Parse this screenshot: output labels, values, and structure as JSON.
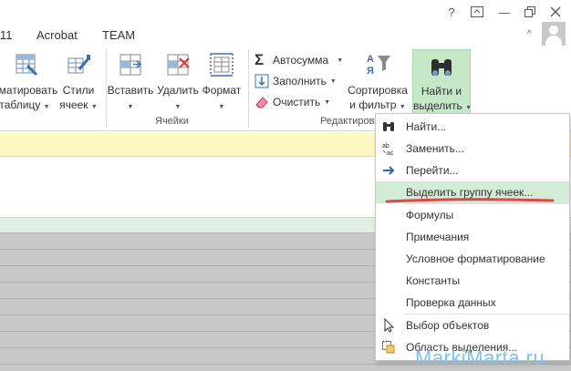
{
  "titlebar": {
    "help": "?",
    "restore_icon": "ribbon-display-icon",
    "minimize": "—"
  },
  "tabs": [
    {
      "label": "11"
    },
    {
      "label": "Acrobat"
    },
    {
      "label": "TEAM"
    }
  ],
  "ribbon_minimize": "^",
  "ribbon": {
    "format_table": {
      "line1": "рматировать",
      "line2": "таблицу"
    },
    "cell_styles": {
      "line1": "Стили",
      "line2": "ячеек"
    },
    "insert": {
      "label": "Вставить"
    },
    "delete": {
      "label": "Удалить"
    },
    "format": {
      "label": "Формат"
    },
    "cells_group": "Ячейки",
    "autosum": "Автосумма",
    "fill": "Заполнить",
    "clear": "Очистить",
    "sort_filter": {
      "line1": "Сортировка",
      "line2": "и фильтр"
    },
    "find_select": {
      "line1": "Найти и",
      "line2": "выделить"
    },
    "editing_group": "Редактирова"
  },
  "menu": {
    "items": [
      {
        "label": "Найти...",
        "icon": "binoculars-icon"
      },
      {
        "label": "Заменить...",
        "icon": "replace-icon"
      },
      {
        "label": "Перейти...",
        "icon": "arrow-right-icon"
      },
      {
        "label": "Выделить группу ячеек...",
        "icon": "",
        "highlighted": true
      },
      {
        "label": "Формулы",
        "icon": ""
      },
      {
        "label": "Примечания",
        "icon": ""
      },
      {
        "label": "Условное форматирование",
        "icon": ""
      },
      {
        "label": "Константы",
        "icon": ""
      },
      {
        "label": "Проверка данных",
        "icon": ""
      },
      {
        "label": "Выбор объектов",
        "icon": "cursor-icon"
      },
      {
        "label": "Область выделения...",
        "icon": "selection-pane-icon"
      }
    ]
  },
  "colors": {
    "highlight": "#d3ecd6",
    "find_button": "#c5e8c9",
    "formula_band": "#fdf7c2",
    "sheet_grey": "#c8c8c8",
    "accent_red": "#e0474c",
    "watermark": "#7ec3ea"
  },
  "watermark": "MarkiMarta.ru"
}
